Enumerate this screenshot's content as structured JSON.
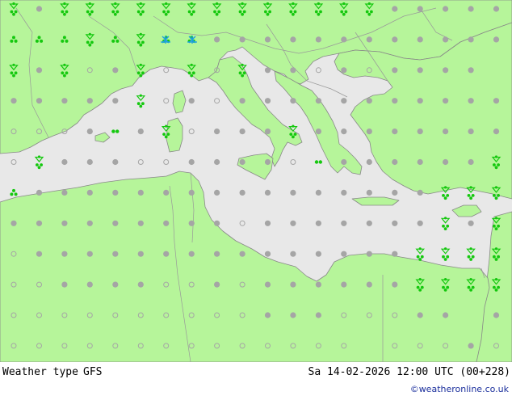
{
  "map": {
    "colors": {
      "land": "#b6f59a",
      "sea": "#e8e8e8",
      "border": "#999999",
      "coast": "#888888",
      "dry": "#a5a5a5",
      "rain": "#15c80f",
      "snow": "#1c9ee6"
    },
    "symbol_legend": {
      "ring": "clear",
      "half": "partly-cloudy",
      "dot": "overcast",
      "drops2": "rain",
      "drops3": "rain-showers",
      "shower": "rain-shower-cloud",
      "snow": "snow"
    },
    "grid_rows": [
      "sdsssssssssssssddddddddd",
      "qqqsqsqqddddddddddddddds",
      "sdsodsososddododddd-dddd",
      "dddddsododdddddddddddd-d",
      "ooodpdsodddsdddddddddddd",
      "osdddooddddopddddddssssq",
      "qddddddddddddddddssss-ss",
      "dddddddddodddddddsdsssss",
      "odddddddddddddddsssssddd",
      "ooddddoododdddddssssssdd",
      "oooooooooodddooodd-ddddd",
      "oooooooooooooo-ooododdoo",
      "oooooooooooooooooooooddd"
    ]
  },
  "footer": {
    "title": "Weather type",
    "model": "GFS",
    "datetime": "Sa 14-02-2026 12:00 UTC (00+228)",
    "credit": "©weatheronline.co.uk"
  }
}
